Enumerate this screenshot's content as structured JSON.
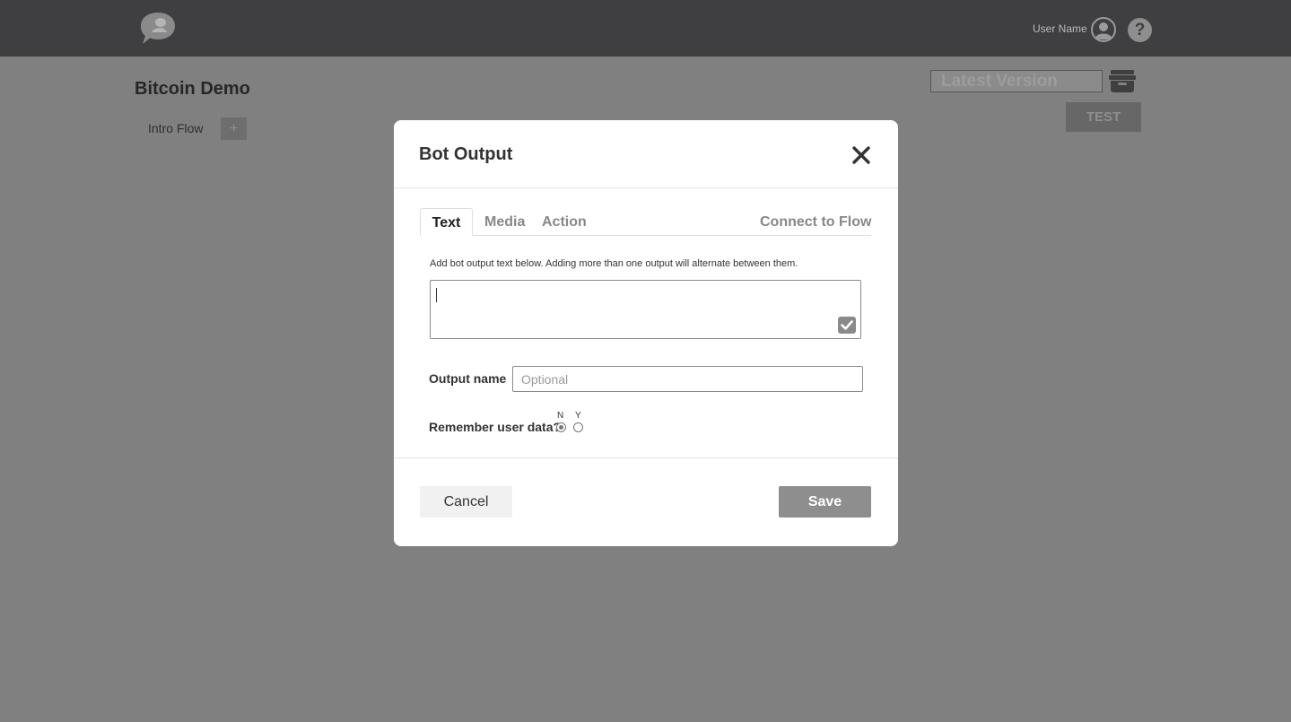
{
  "header": {
    "user_name": "User Name",
    "help_label": "?"
  },
  "page": {
    "title": "Bitcoin Demo",
    "flow_tab": "Intro Flow",
    "add_flow_label": "+",
    "version_value": "Latest Version",
    "test_label": "TEST"
  },
  "modal": {
    "title": "Bot Output",
    "tabs": [
      {
        "label": "Text",
        "active": true
      },
      {
        "label": "Media",
        "active": false
      },
      {
        "label": "Action",
        "active": false
      }
    ],
    "connect_label": "Connect to Flow",
    "hint": "Add bot output text below. Adding more than one output will alternate between them.",
    "output_text": "",
    "output_name_label": "Output name",
    "output_name_placeholder": "Optional",
    "remember_label": "Remember user data?",
    "remember_options": [
      {
        "label": "N",
        "selected": true
      },
      {
        "label": "Y",
        "selected": false
      }
    ],
    "cancel_label": "Cancel",
    "save_label": "Save"
  },
  "colors": {
    "overlay": "#808080",
    "topbar": "#3f3f41",
    "save_button": "#8e8e8e",
    "modal_bg": "#ffffff"
  },
  "icons": {
    "logo": "chat-bubble-logo-icon",
    "avatar": "user-avatar-icon",
    "help": "question-icon",
    "archive": "archive-icon",
    "close": "close-icon",
    "confirm": "checkmark-icon"
  }
}
